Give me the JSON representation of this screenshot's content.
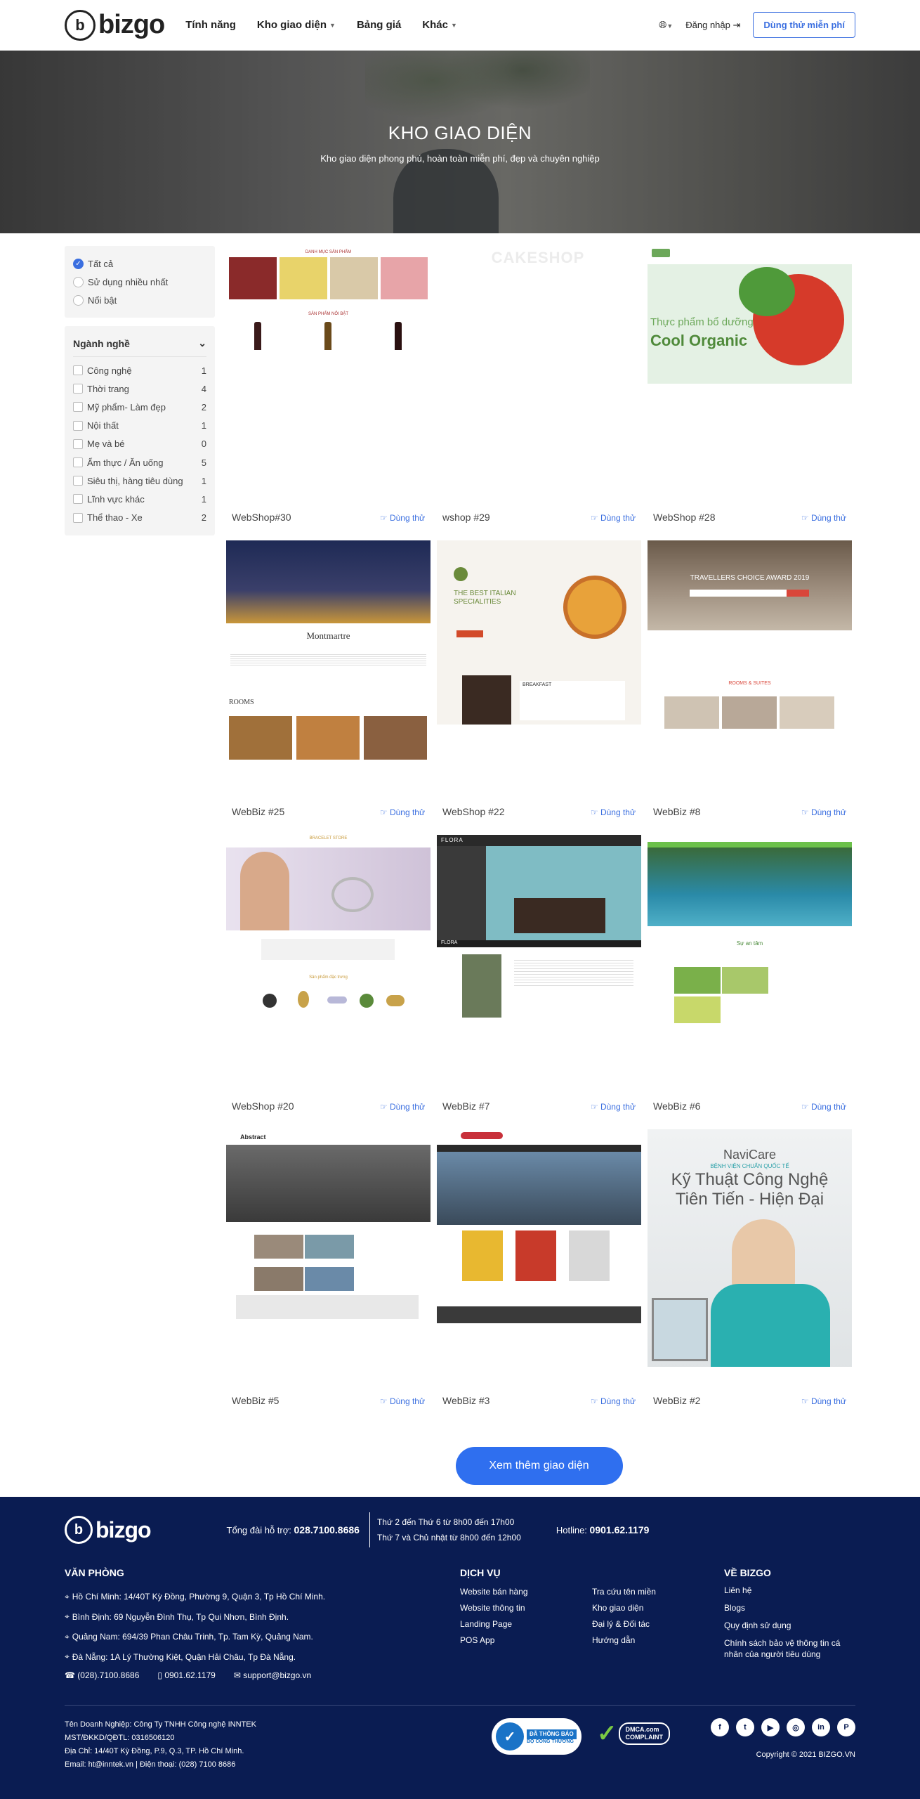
{
  "header": {
    "logo_letter": "b",
    "logo_text": "bizgo",
    "nav": [
      {
        "label": "Tính năng"
      },
      {
        "label": "Kho giao diện"
      },
      {
        "label": "Bảng giá"
      },
      {
        "label": "Khác"
      }
    ],
    "login_label": "Đăng nhập",
    "try_label": "Dùng thử miễn phí"
  },
  "hero": {
    "title": "KHO GIAO DIỆN",
    "subtitle": "Kho giao diện phong phú, hoàn toàn miễn phí, đẹp và chuyên nghiệp"
  },
  "filters": {
    "sort": [
      {
        "label": "Tất cả",
        "selected": true
      },
      {
        "label": "Sử dụng nhiều nhất",
        "selected": false
      },
      {
        "label": "Nổi bật",
        "selected": false
      }
    ],
    "category_title": "Ngành nghề",
    "categories": [
      {
        "label": "Công nghệ",
        "count": "1"
      },
      {
        "label": "Thời trang",
        "count": "4"
      },
      {
        "label": "Mỹ phẩm- Làm đẹp",
        "count": "2"
      },
      {
        "label": "Nội thất",
        "count": "1"
      },
      {
        "label": "Mẹ và bé",
        "count": "0"
      },
      {
        "label": "Ẩm thực / Ăn uống",
        "count": "5"
      },
      {
        "label": "Siêu thị, hàng tiêu dùng",
        "count": "1"
      },
      {
        "label": "Lĩnh vực khác",
        "count": "1"
      },
      {
        "label": "Thể thao - Xe",
        "count": "2"
      }
    ]
  },
  "templates": [
    {
      "name": "WebShop#30",
      "try": "Dùng thử",
      "thumb_text": "DANH MỤC SẢN PHẨM",
      "thumb_text2": "SẢN PHẨM NỔI BẬT"
    },
    {
      "name": "wshop #29",
      "try": "Dùng thử",
      "thumb_text": "CAKESHOP",
      "thumb_text2": ""
    },
    {
      "name": "WebShop #28",
      "try": "Dùng thử",
      "thumb_text": "Thực phẩm bổ dưỡng",
      "thumb_text2": "Cool Organic"
    },
    {
      "name": "WebBiz #25",
      "try": "Dùng thử",
      "thumb_text": "Montmartre",
      "thumb_text2": "ROOMS"
    },
    {
      "name": "WebShop #22",
      "try": "Dùng thử",
      "thumb_text": "THE BEST ITALIAN SPECIALITIES",
      "thumb_text2": "BREAKFAST"
    },
    {
      "name": "WebBiz #8",
      "try": "Dùng thử",
      "thumb_text": "TRAVELLERS CHOICE AWARD 2019",
      "thumb_text2": "ROOMS & SUITES"
    },
    {
      "name": "WebShop #20",
      "try": "Dùng thử",
      "thumb_text": "BRACELET STORE",
      "thumb_text2": "Sản phẩm đặc trưng"
    },
    {
      "name": "WebBiz #7",
      "try": "Dùng thử",
      "thumb_text": "FLORA",
      "thumb_text2": "FLORA"
    },
    {
      "name": "WebBiz #6",
      "try": "Dùng thử",
      "thumb_text": "Sự an tâm",
      "thumb_text2": ""
    },
    {
      "name": "WebBiz #5",
      "try": "Dùng thử",
      "thumb_text": "Abstract",
      "thumb_text2": ""
    },
    {
      "name": "WebBiz #3",
      "try": "Dùng thử",
      "thumb_text": "",
      "thumb_text2": ""
    },
    {
      "name": "WebBiz #2",
      "try": "Dùng thử",
      "thumb_text": "NaviCare",
      "thumb_text2": "Kỹ Thuật Công Nghệ Tiên Tiến - Hiện Đại",
      "thumb_text3": "BỆNH VIỆN CHUẨN QUỐC TẾ"
    }
  ],
  "more_label": "Xem thêm giao diện",
  "footer": {
    "support_label": "Tổng đài hỗ trợ:",
    "support_phone": "028.7100.8686",
    "hours1": "Thứ 2 đến Thứ 6 từ 8h00 đến 17h00",
    "hours2": "Thứ 7 và Chủ nhật từ 8h00 đến 12h00",
    "hotline_label": "Hotline:",
    "hotline": "0901.62.1179",
    "office_title": "VĂN PHÒNG",
    "offices": [
      "Hồ Chí Minh: 14/40T Kỳ Đồng, Phường 9, Quận 3, Tp Hồ Chí Minh.",
      "Bình Định: 69 Nguyễn Đình Thụ, Tp Qui Nhơn, Bình Định.",
      "Quảng Nam: 694/39 Phan Châu Trinh, Tp. Tam Kỳ, Quảng Nam.",
      "Đà Nẵng: 1A Lý Thường Kiệt, Quận Hải Châu, Tp Đà Nẵng."
    ],
    "phone1": "(028).7100.8686",
    "phone2": "0901.62.1179",
    "email": "support@bizgo.vn",
    "service_title": "DỊCH VỤ",
    "services": [
      "Website bán hàng",
      "Tra cứu tên miền",
      "Website thông tin",
      "Kho giao diện",
      "Landing Page",
      "Đại lý & Đối tác",
      "POS App",
      "Hướng dẫn"
    ],
    "about_title": "VỀ BIZGO",
    "about": [
      "Liên hệ",
      "Blogs",
      "Quy định sử dụng",
      "Chính sách bảo vệ thông tin cá nhân của người tiêu dùng"
    ],
    "company": [
      "Tên Doanh Nghiệp: Công Ty TNHH Công nghệ INNTEK",
      "MST/ĐKKD/QĐTL: 0316506120",
      "Địa Chỉ: 14/40T Kỳ Đồng, P.9, Q.3, TP. Hồ Chí Minh.",
      "Email: ht@inntek.vn | Điện thoại: (028) 7100 8686"
    ],
    "badge1": "ĐÃ THÔNG BÁO",
    "badge1_sub": "BỘ CÔNG THƯƠNG",
    "badge2": "DMCA.com",
    "badge2_sub": "COMPLAINT",
    "socials": [
      "f",
      "t",
      "▶",
      "◎",
      "in",
      "P"
    ],
    "copyright": "Copyright © 2021  BIZGO.VN"
  }
}
